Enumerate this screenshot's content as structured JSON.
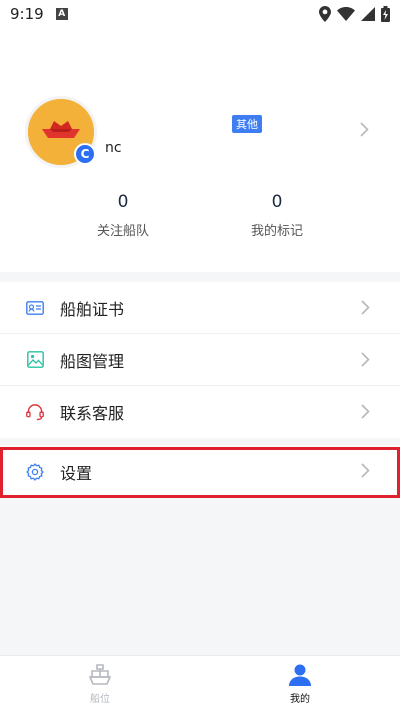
{
  "status_bar": {
    "time": "9:19",
    "a_badge": "A"
  },
  "profile": {
    "username": "nc",
    "avatar_badge": "C",
    "tag": "其他",
    "stats": [
      {
        "value": "0",
        "label": "关注船队"
      },
      {
        "value": "0",
        "label": "我的标记"
      }
    ]
  },
  "menu": {
    "items": [
      {
        "label": "船舶证书",
        "icon": "id-card-icon",
        "color": "#3f7ef2"
      },
      {
        "label": "船图管理",
        "icon": "image-icon",
        "color": "#27c2a0"
      },
      {
        "label": "联系客服",
        "icon": "headset-icon",
        "color": "#e0353a"
      }
    ],
    "settings": {
      "label": "设置",
      "icon": "gear-icon",
      "color": "#3f7ef2"
    }
  },
  "bottom_nav": {
    "items": [
      {
        "label": "船位",
        "active": false
      },
      {
        "label": "我的",
        "active": true
      }
    ]
  },
  "colors": {
    "accent": "#3f7ef2",
    "highlight": "#e0222f",
    "avatar": "#f4b13a"
  }
}
